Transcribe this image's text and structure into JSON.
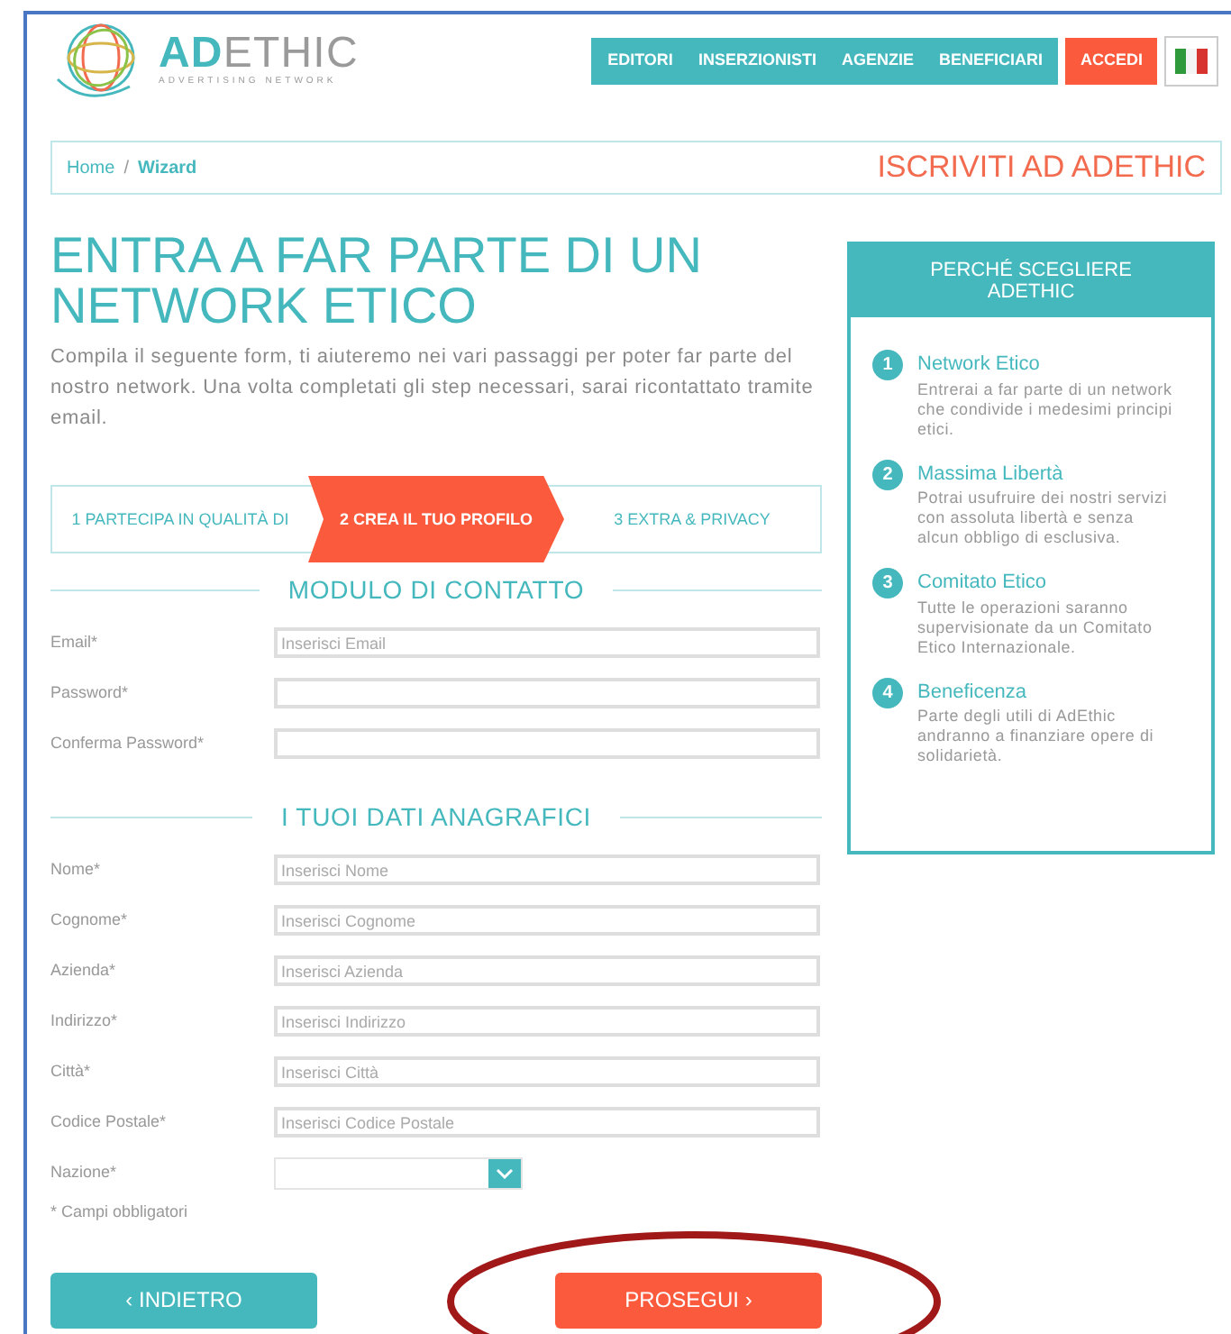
{
  "logo": {
    "name": "**AD**ETHIC",
    "tagline": "ADVERTISING NETWORK"
  },
  "nav": [
    {
      "label": "EDITORI",
      "kind": "link"
    },
    {
      "label": "INSERZIONISTI",
      "kind": "link"
    },
    {
      "label": "AGENZIE",
      "kind": "link"
    },
    {
      "label": "BENEFICIARI",
      "kind": "link"
    },
    {
      "label": "ACCEDI",
      "kind": "login"
    },
    {
      "kind": "flag"
    }
  ],
  "breadcrumb": [
    {
      "label": "Home",
      "selected": false
    },
    {
      "label": "Wizard",
      "selected": true
    }
  ],
  "breadcrumb_separator": "/",
  "page_heading": "ISCRIVITI AD ADETHIC",
  "title": "ENTRA A FAR PARTE DI UN NETWORK ETICO",
  "intro": "Compila il seguente form, ti aiuteremo nei vari passaggi per poter far parte del nostro network. Una volta completati gli step necessari, sarai ricontattato tramite email.",
  "steps": [
    {
      "label": "1  PARTECIPA IN QUALITÀ DI",
      "selected": false
    },
    {
      "label": "2  CREA IL TUO PROFILO",
      "selected": true
    },
    {
      "label": "3  EXTRA & PRIVACY",
      "selected": false
    }
  ],
  "sections": [
    {
      "title": "MODULO DI CONTATTO",
      "fields": [
        {
          "label": "Email*",
          "kind": "text",
          "placeholder": "Inserisci Email"
        },
        {
          "label": "Password*",
          "kind": "password"
        },
        {
          "label": "Conferma Password*",
          "kind": "password"
        }
      ]
    },
    {
      "title": "I TUOI DATI ANAGRAFICI",
      "fields": [
        {
          "label": "Nome*",
          "kind": "text",
          "placeholder": "Inserisci Nome"
        },
        {
          "label": "Cognome*",
          "kind": "text",
          "placeholder": "Inserisci Cognome"
        },
        {
          "label": "Azienda*",
          "kind": "text",
          "placeholder": "Inserisci Azienda"
        },
        {
          "label": "Indirizzo*",
          "kind": "text",
          "placeholder": "Inserisci Indirizzo"
        },
        {
          "label": "Città*",
          "kind": "text",
          "placeholder": "Inserisci Città"
        },
        {
          "label": "Codice Postale*",
          "kind": "text",
          "placeholder": "Inserisci Codice Postale"
        },
        {
          "label": "Nazione*",
          "kind": "select"
        }
      ]
    }
  ],
  "required_note": "* Campi obbligatori",
  "buttons": [
    {
      "label": "‹ INDIETRO",
      "kind": "back"
    },
    {
      "label": "PROSEGUI ›",
      "kind": "next"
    }
  ],
  "sidebar": {
    "title": "PERCHÉ SCEGLIERE ADETHIC",
    "items": [
      {
        "number": "1",
        "title": "Network Etico",
        "text": "Entrerai a far parte di un network che condivide i medesimi principi etici."
      },
      {
        "number": "2",
        "title": "Massima Libertà",
        "text": "Potrai usufruire dei nostri servizi con assoluta libertà e senza alcun obbligo di esclusiva."
      },
      {
        "number": "3",
        "title": "Comitato Etico",
        "text": "Tutte le operazioni saranno supervisionate da un Comitato Etico Internazionale."
      },
      {
        "number": "4",
        "title": "Beneficenza",
        "text": "Parte degli utili di AdEthic andranno a finanziare opere di solidarietà."
      }
    ]
  }
}
